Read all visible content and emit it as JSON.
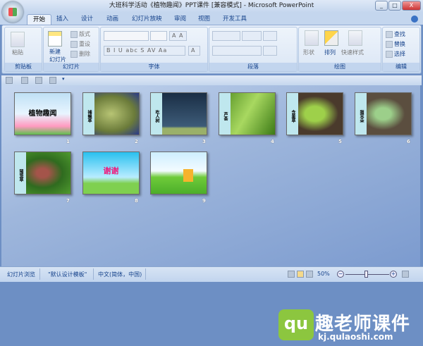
{
  "window": {
    "title": "大班科学活动《植物趣闻》PPT课件 [兼容模式] - Microsoft PowerPoint",
    "min": "_",
    "max": "□",
    "close": "X"
  },
  "tabs": [
    "开始",
    "插入",
    "设计",
    "动画",
    "幻灯片放映",
    "审阅",
    "视图",
    "开发工具"
  ],
  "ribbon": {
    "clipboard": {
      "label": "剪贴板",
      "paste": "粘贴"
    },
    "slides": {
      "label": "幻灯片",
      "new_slide_1": "新建",
      "new_slide_2": "幻灯片",
      "layout": "版式",
      "reset": "重设",
      "delete": "删除"
    },
    "font": {
      "label": "字体",
      "buttons": "B I U abc S AV Aa",
      "grow": "A A",
      "color": "A"
    },
    "paragraph": {
      "label": "段落"
    },
    "drawing": {
      "label": "绘图",
      "shapes": "形状",
      "arrange": "排列",
      "quick_styles": "快速样式"
    },
    "editing": {
      "label": "编辑",
      "find": "查找",
      "replace": "替换",
      "select": "选择"
    }
  },
  "slides": [
    {
      "num": "1",
      "title": "植物趣闻"
    },
    {
      "num": "2",
      "title": "捕蝇草"
    },
    {
      "num": "3",
      "title": "吃人树"
    },
    {
      "num": "4",
      "title": "芦荟"
    },
    {
      "num": "5",
      "title": "含羞草"
    },
    {
      "num": "6",
      "title": "猫耳朵"
    },
    {
      "num": "7",
      "title": "猪笼草"
    },
    {
      "num": "8",
      "title": "谢谢"
    },
    {
      "num": "9",
      "title": ""
    }
  ],
  "watermark": {
    "logo": "qu",
    "name": "趣老师课件",
    "url": "kj.qulaoshi.com"
  },
  "status": {
    "view": "幻灯片浏览",
    "theme": "\"默认设计模板\"",
    "language": "中文(简体，中国)",
    "zoom": "50%",
    "zoom_percent": 50
  }
}
